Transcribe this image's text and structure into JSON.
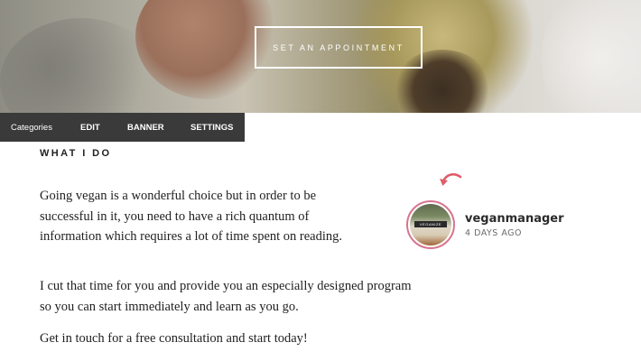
{
  "hero": {
    "cta_label": "SET AN APPOINTMENT"
  },
  "toolbar": {
    "categories_label": "Categories",
    "edit_label": "EDIT",
    "banner_label": "BANNER",
    "settings_label": "SETTINGS"
  },
  "content": {
    "section_title": "WHAT I DO",
    "paragraphs": [
      "Going vegan is a wonderful choice but in order to be successful in it, you need to have a rich quantum of information which requires a lot of time spent on reading.",
      "I cut that time for you and provide you an especially designed program so you can start immediately and learn as you go.",
      "Get in touch for a free consultation and start today!"
    ]
  },
  "profile": {
    "username": "veganmanager",
    "time_ago": "4 DAYS AGO",
    "avatar_label": "VEGANIZE",
    "ring_color": "#d8748e",
    "arrow_color": "#e05c6a",
    "arrow_icon": "curved-arrow-icon"
  }
}
